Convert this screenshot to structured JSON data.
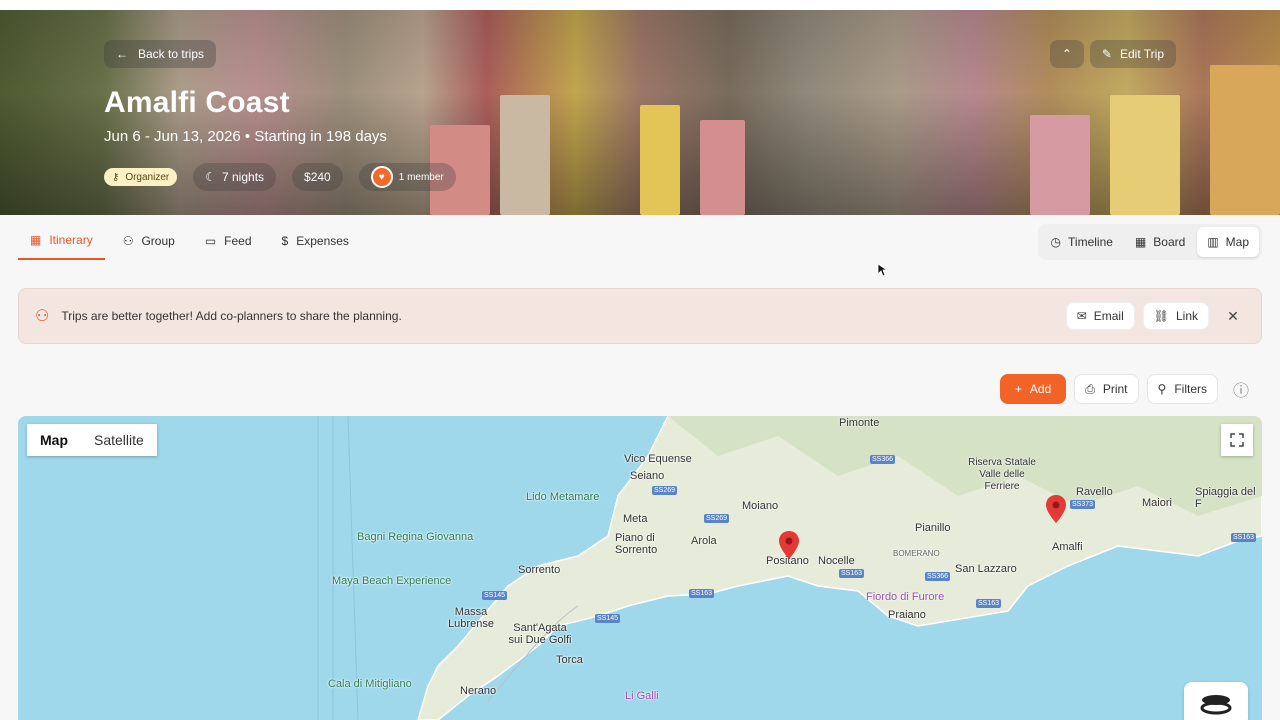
{
  "hero": {
    "back_label": "Back to trips",
    "title": "Amalfi Coast",
    "dates": "Jun 6 - Jun 13, 2026 • Starting in 198 days",
    "organizer": "Organizer",
    "nights": "7 nights",
    "cost": "$240",
    "members": "1 member",
    "edit_label": "Edit Trip"
  },
  "tabs": [
    {
      "label": "Itinerary",
      "icon": "calendar-icon"
    },
    {
      "label": "Group",
      "icon": "users-icon"
    },
    {
      "label": "Feed",
      "icon": "chat-icon"
    },
    {
      "label": "Expenses",
      "icon": "dollar-icon"
    }
  ],
  "views": [
    {
      "label": "Timeline",
      "icon": "clock-icon"
    },
    {
      "label": "Board",
      "icon": "grid-icon"
    },
    {
      "label": "Map",
      "icon": "map-icon"
    }
  ],
  "banner": {
    "text": "Trips are better together! Add co-planners to share the planning.",
    "email_label": "Email",
    "link_label": "Link"
  },
  "toolbar": {
    "add_label": "Add",
    "print_label": "Print",
    "filters_label": "Filters"
  },
  "map": {
    "type_map": "Map",
    "type_satellite": "Satellite",
    "places": [
      "Pimonte",
      "Vico Equense",
      "Seiano",
      "Lido Metamare",
      "Moiano",
      "Meta",
      "Piano di Sorrento",
      "Arola",
      "Positano",
      "Nocelle",
      "Pianillo",
      "Riserva Statale Valle delle Ferriere",
      "Ravello",
      "Maiori",
      "Spiaggia del F",
      "Amalfi",
      "Bagni Regina Giovanna",
      "Sorrento",
      "Maya Beach Experience",
      "Massa Lubrense",
      "Sant'Agata sui Due Golfi",
      "Torca",
      "Nerano",
      "Cala di Mitigliano",
      "Li Galli",
      "Fiordo di Furore",
      "Praiano",
      "San Lazzaro",
      "BOMERANO"
    ],
    "roads": [
      "SS366",
      "SS269",
      "SS269",
      "SS373",
      "SS163",
      "SS145",
      "SS145",
      "SS163",
      "SS366",
      "SS163",
      "SS163"
    ]
  },
  "colors": {
    "accent": "#f26327",
    "active_tab": "#e5582b",
    "water": "#9fd8ea",
    "land": "#e8eedd",
    "pin": "#e53935"
  }
}
